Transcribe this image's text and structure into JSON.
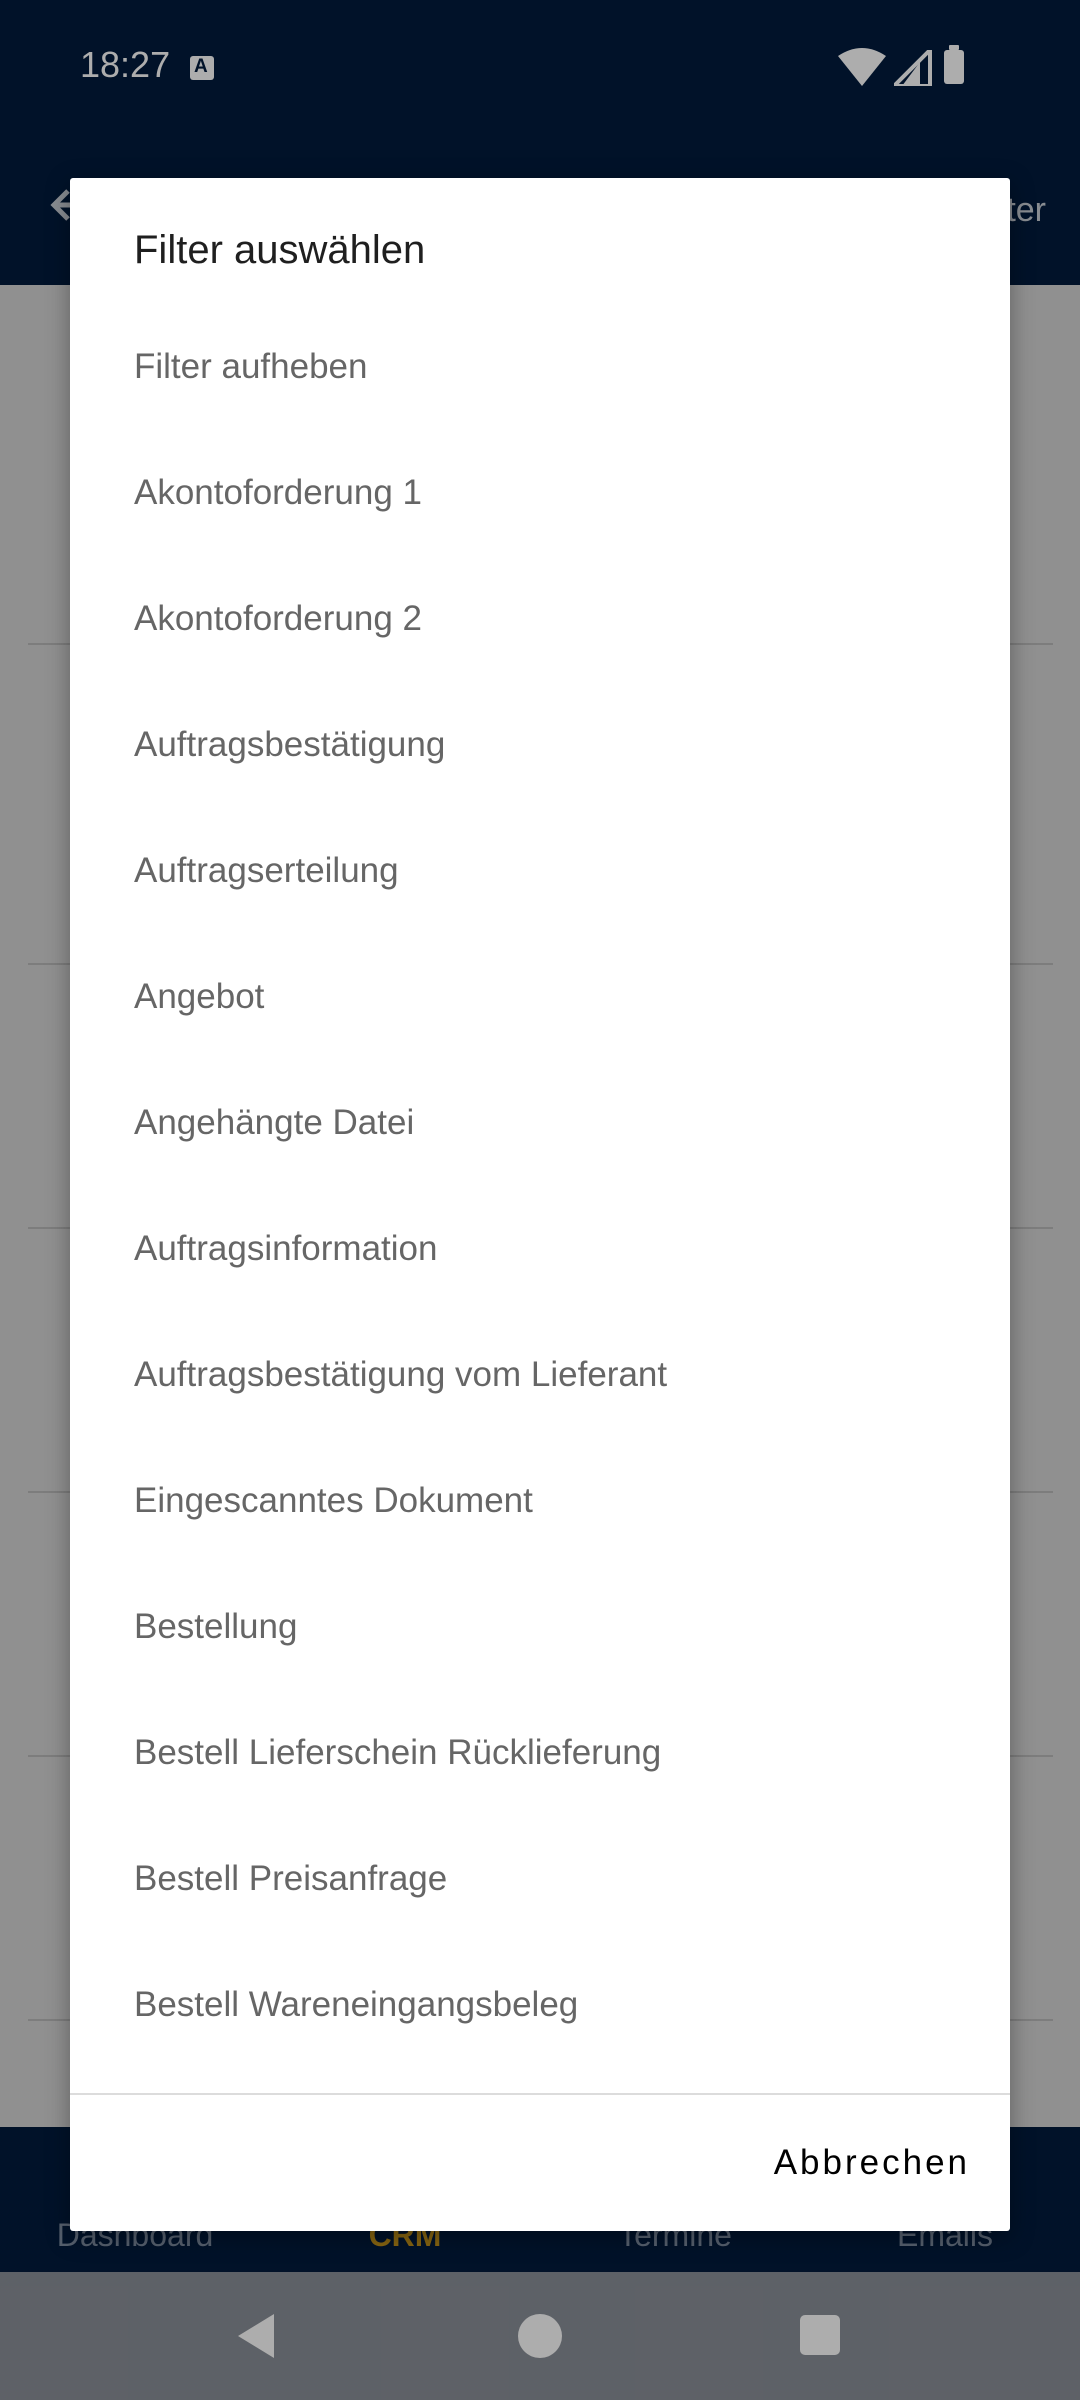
{
  "status_bar": {
    "time": "18:27"
  },
  "app_bar": {
    "action_partial": "ter"
  },
  "bottom_nav": {
    "items": [
      {
        "label": "Dashboard"
      },
      {
        "label": "CRM"
      },
      {
        "label": "Termine"
      },
      {
        "label": "Emails"
      }
    ],
    "active_color": "#c8951a"
  },
  "dialog": {
    "title": "Filter auswählen",
    "options": [
      {
        "label": "Filter aufheben"
      },
      {
        "label": "Akontoforderung 1"
      },
      {
        "label": "Akontoforderung 2"
      },
      {
        "label": "Auftragsbestätigung"
      },
      {
        "label": "Auftragserteilung"
      },
      {
        "label": "Angebot"
      },
      {
        "label": "Angehängte Datei"
      },
      {
        "label": "Auftragsinformation"
      },
      {
        "label": "Auftragsbestätigung vom Lieferant"
      },
      {
        "label": "Eingescanntes Dokument"
      },
      {
        "label": "Bestellung"
      },
      {
        "label": "Bestell Lieferschein Rücklieferung"
      },
      {
        "label": "Bestell Preisanfrage"
      },
      {
        "label": "Bestell Wareneingangsbeleg"
      }
    ],
    "cancel_label": "Abbrechen"
  },
  "colors": {
    "primary_dark": "#021b3d",
    "accent": "#c8951a"
  }
}
